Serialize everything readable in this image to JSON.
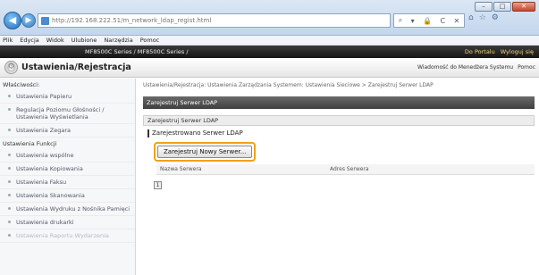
{
  "browser": {
    "address": "http://192.168.222.51/m_network_ldap_regist.html",
    "address_tools": [
      "⌕",
      "▾",
      "🔒",
      "C",
      "✕"
    ],
    "window_buttons": [
      "–",
      "□",
      "✕"
    ],
    "tab_icons": [
      "⌂",
      "☆",
      "⚙"
    ]
  },
  "menu": [
    "Plik",
    "Edycja",
    "Widok",
    "Ulubione",
    "Narzędzia",
    "Pomoc"
  ],
  "device_bar": {
    "name": "MF8500C Series / MF8500C Series /",
    "right_links": [
      "Do Portalu",
      "Wyloguj się"
    ]
  },
  "page_header": {
    "title": "Ustawienia/Rejestracja",
    "links": [
      "Wiadomość do Menedżera Systemu",
      "Pomoc"
    ]
  },
  "sidebar": {
    "heading1": "Właściwości:",
    "items1": [
      "Ustawienia Papieru",
      "Regulacja Poziomu Głośności / Ustawienia Wyświetlania",
      "Ustawienia Zegara"
    ],
    "heading2": "Ustawienia Funkcji",
    "items2": [
      "Ustawienia wspólne",
      "Ustawienia Kopiowania",
      "Ustawienia Faksu",
      "Ustawienia Skanowania",
      "Ustawienia Wydruku z Nośnika Pamięci",
      "Ustawienia drukarki",
      "Ustawienia Raportu Wydarzenia"
    ]
  },
  "main": {
    "breadcrumb": "Ustawienia/Rejestracja: Ustawienia Zarządzania Systemem: Ustawienia Sieciowe > Zarejestruj Serwer LDAP",
    "title": "Zarejestruj Serwer LDAP",
    "section": "Zarejestruj Serwer LDAP",
    "sub_section": "Zarejestrowano Serwer LDAP",
    "button": "Zarejestruj Nowy Serwer...",
    "table_headers": [
      "Nazwa Serwera",
      "Adres Serwera"
    ],
    "pager": "1"
  }
}
